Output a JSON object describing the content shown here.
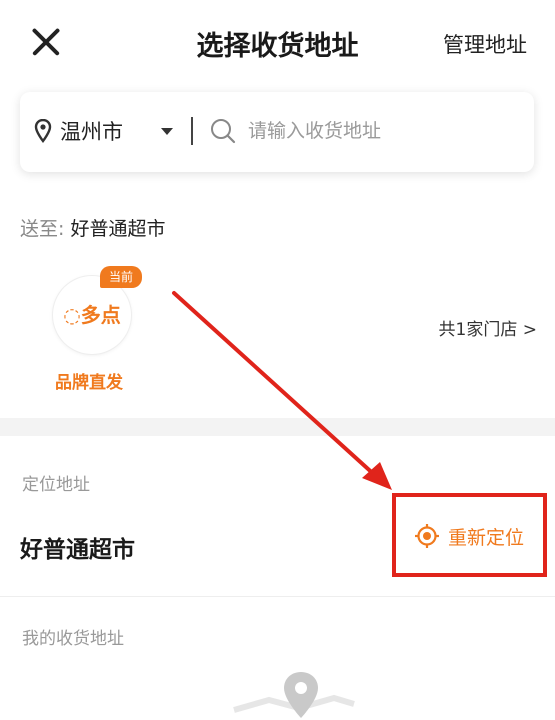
{
  "header": {
    "title": "选择收货地址",
    "manage_label": "管理地址"
  },
  "search": {
    "city": "温州市",
    "placeholder": "请输入收货地址"
  },
  "delivery": {
    "prefix": "送至:",
    "store_name": "好普通超市"
  },
  "store": {
    "logo_text": "多点",
    "badge": "当前",
    "brand_label": "品牌直发",
    "count_label": "共1家门店 >"
  },
  "location": {
    "section_label": "定位地址",
    "name": "好普通超市",
    "relocate_label": "重新定位"
  },
  "my_addresses": {
    "section_label": "我的收货地址"
  },
  "colors": {
    "accent": "#f07a1e",
    "highlight": "#e0241b"
  }
}
